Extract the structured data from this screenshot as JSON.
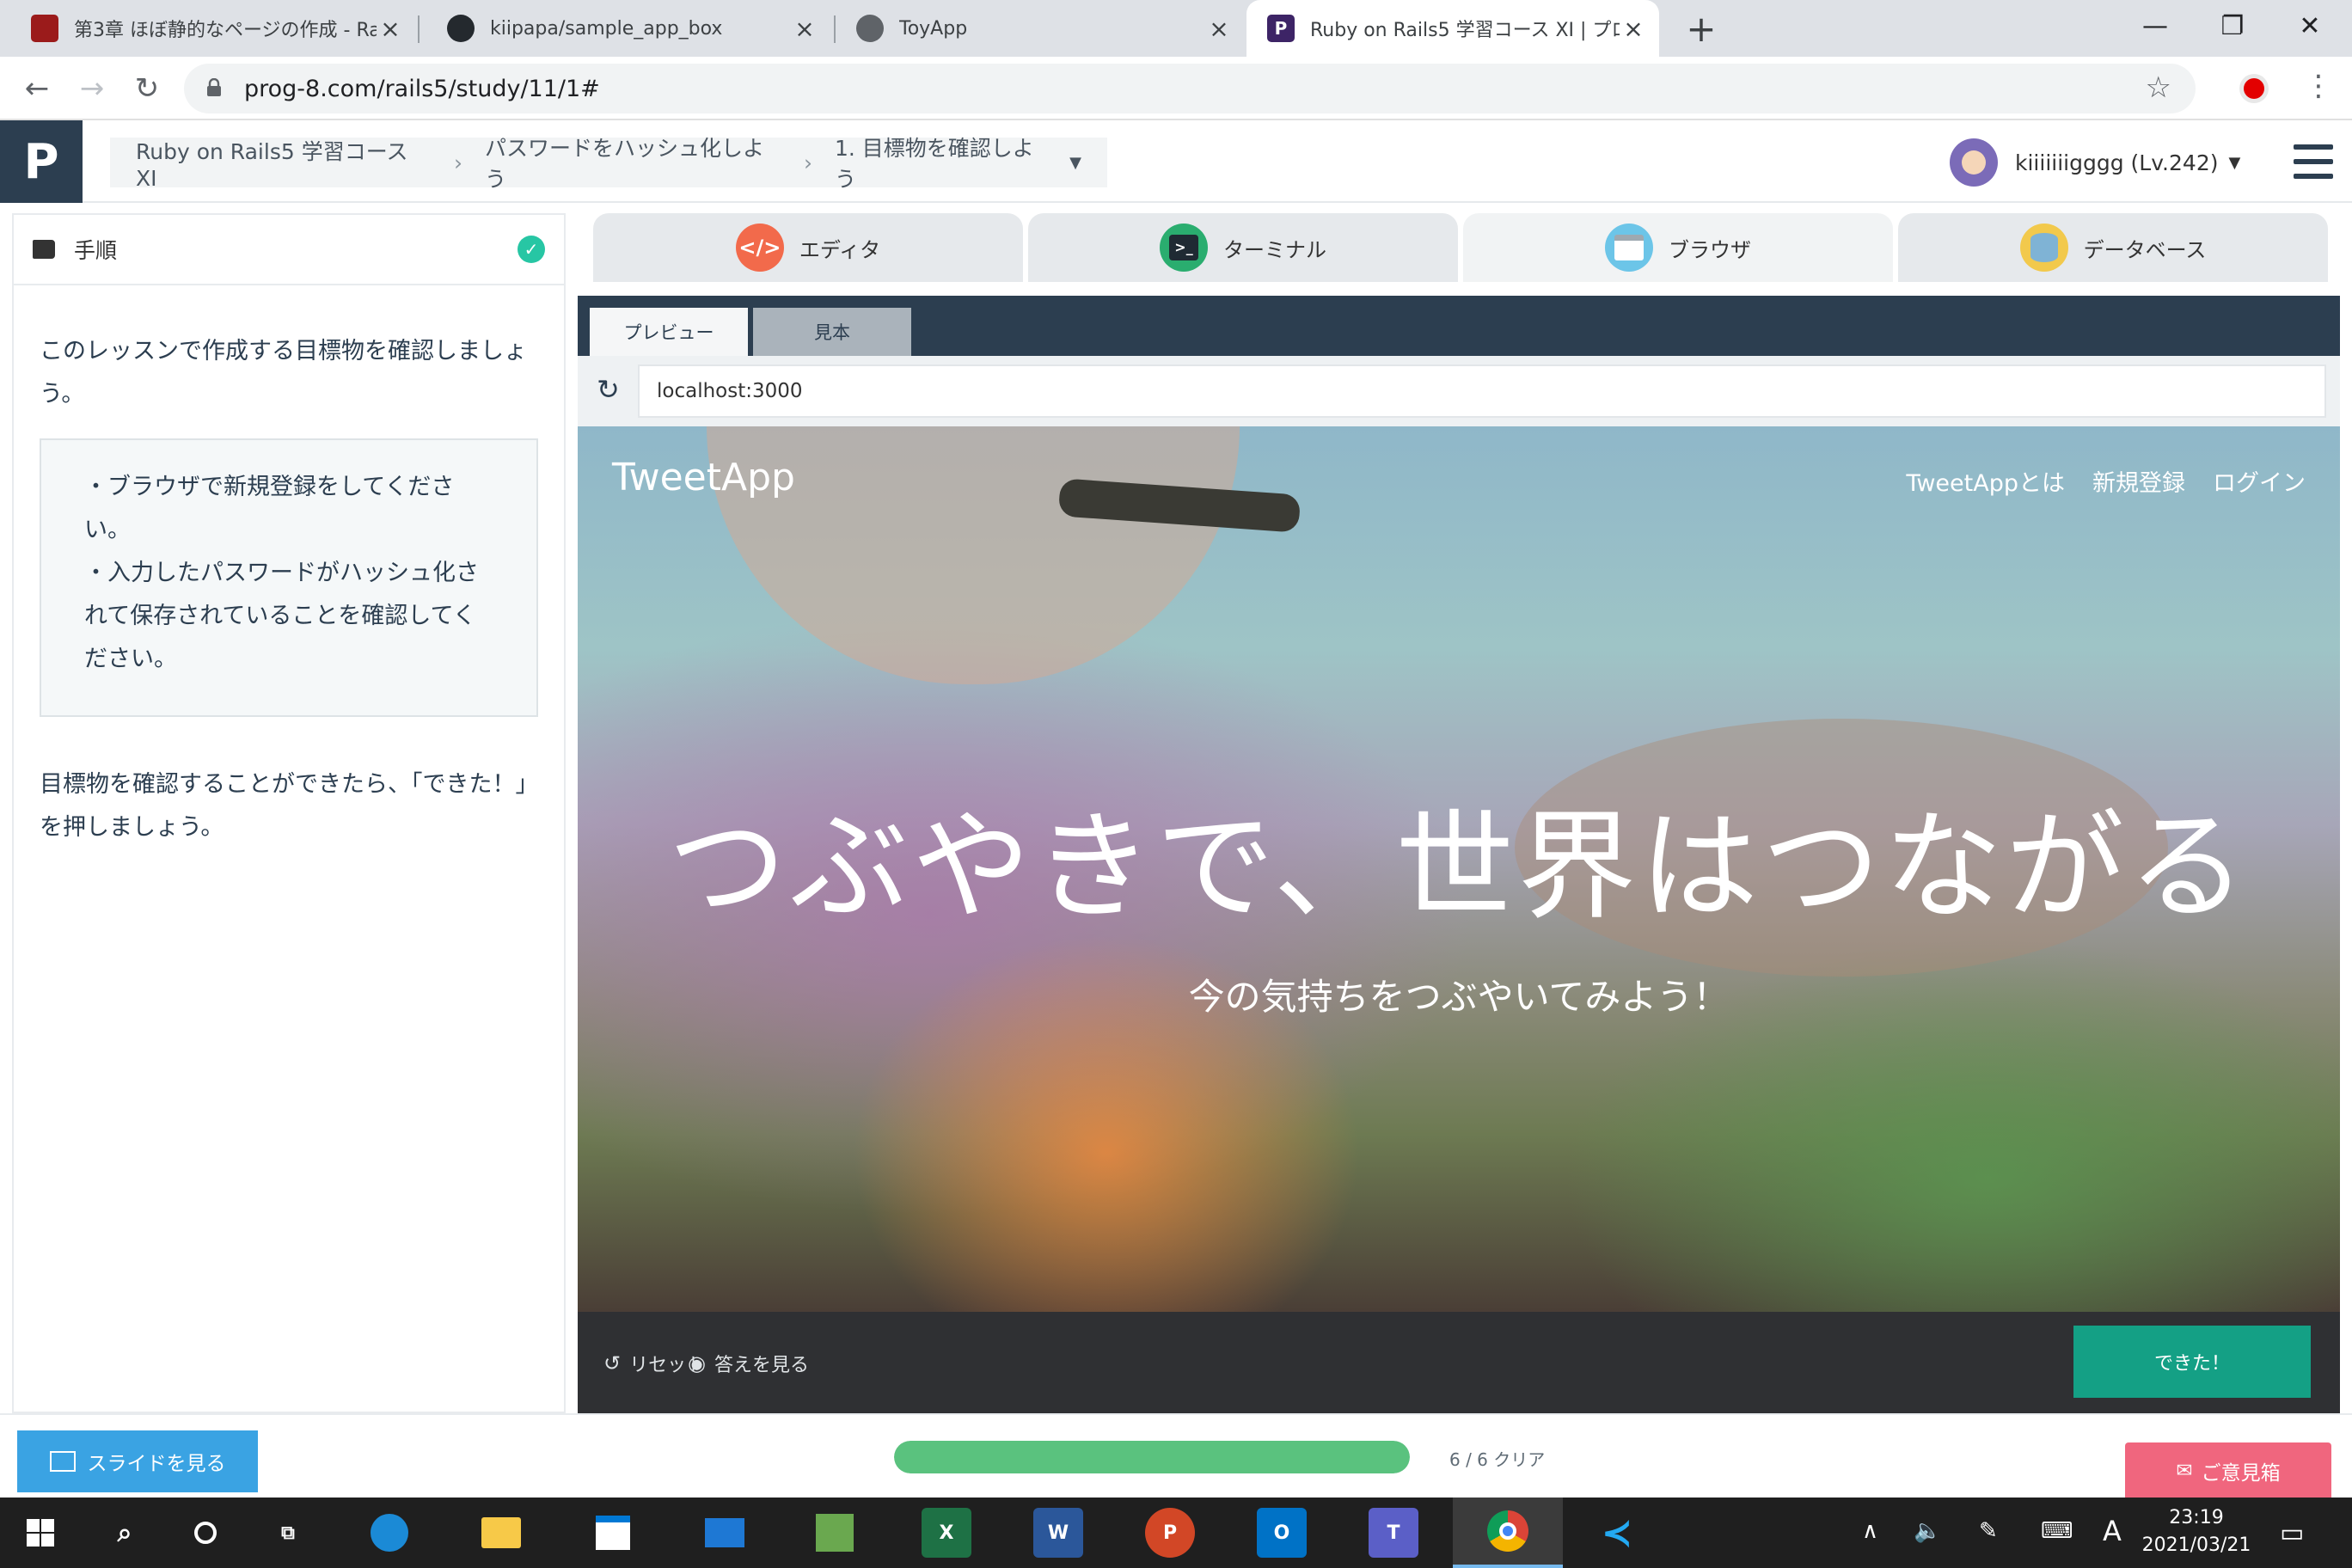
{
  "browser": {
    "tabs": [
      {
        "title": "第3章 ほぼ静的なページの作成 - Ra",
        "icon": "railstutorial-icon",
        "color": "#9b1b1b",
        "glyph": ""
      },
      {
        "title": "kiipapa/sample_app_box",
        "icon": "github-icon",
        "color": "#24292e",
        "glyph": ""
      },
      {
        "title": "ToyApp",
        "icon": "globe-icon",
        "color": "#5f6368",
        "glyph": ""
      },
      {
        "title": "Ruby on Rails5 学習コース XI | プロ",
        "icon": "progate-icon",
        "color": "#3d2466",
        "glyph": "P"
      }
    ],
    "new_tab": "+",
    "url": "prog-8.com/rails5/study/11/1#",
    "window": {
      "minimize": "—",
      "maximize": "❐",
      "close": "✕"
    }
  },
  "header": {
    "logo": "P",
    "breadcrumb": [
      "Ruby on Rails5 学習コース XI",
      "パスワードをハッシュ化しよう",
      "1. 目標物を確認しよう"
    ],
    "user": "kiiiiiiigggg (Lv.242)"
  },
  "left_panel": {
    "title": "手順",
    "intro": "このレッスンで作成する目標物を確認しましょう。",
    "hints": [
      "・ブラウザで新規登録をしてください。",
      "・入力したパスワードがハッシュ化されて保存されていることを確認してください。"
    ],
    "outro": "目標物を確認することができたら、「できた！」を押しましょう。"
  },
  "workspace": {
    "tabs": [
      "エディタ",
      "ターミナル",
      "ブラウザ",
      "データベース"
    ],
    "preview_tabs": [
      "プレビュー",
      "見本"
    ],
    "url": "localhost:3000"
  },
  "hero": {
    "brand": "TweetApp",
    "nav": [
      "TweetAppとは",
      "新規登録",
      "ログイン"
    ],
    "title": "つぶやきで、世界はつながる",
    "subtitle": "今の気持ちをつぶやいてみよう！"
  },
  "actions": {
    "reset": "リセット",
    "answer": "答えを見る",
    "done": "できた！"
  },
  "footer": {
    "slides": "スライドを見る",
    "progress_label": "6 / 6 クリア",
    "progress_fraction": 1.0,
    "feedback": "ご意見箱"
  },
  "taskbar": {
    "time": "23:19",
    "date": "2021/03/21",
    "ime": "A"
  },
  "colors": {
    "progate_navy": "#2c3e50",
    "done_green": "#14a085",
    "progress_green": "#5ac27e",
    "feedback_pink": "#f0667e",
    "slides_blue": "#3aa3e3"
  }
}
